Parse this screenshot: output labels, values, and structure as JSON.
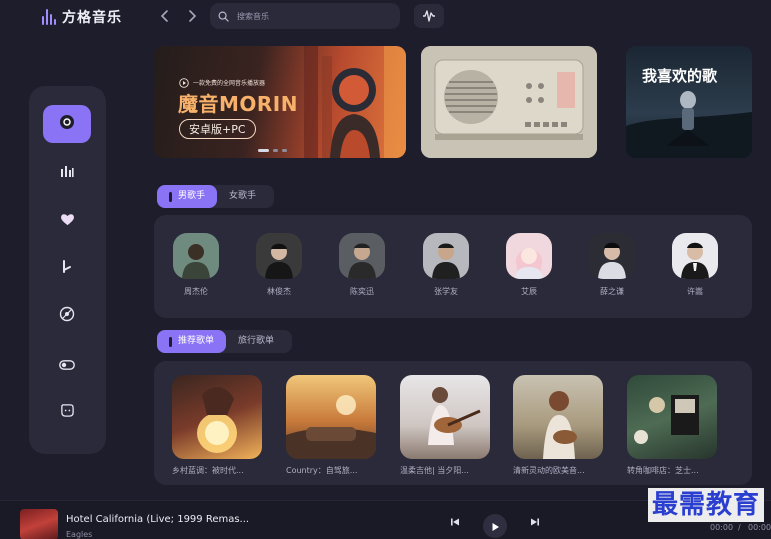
{
  "app": {
    "name": "方格音乐"
  },
  "search": {
    "placeholder": "搜索音乐"
  },
  "banners": {
    "b1_small": "一款免费的全网音乐播放器",
    "b1_title": "魔音MORIN",
    "b1_sub": "安卓版+PC",
    "b3_title": "我喜欢的歌"
  },
  "singer_tabs": [
    {
      "label": "男歌手",
      "active": true
    },
    {
      "label": "女歌手",
      "active": false
    }
  ],
  "singers": [
    {
      "name": "周杰伦",
      "bg": "#6f8a7e"
    },
    {
      "name": "林俊杰",
      "bg": "#3a3a3a"
    },
    {
      "name": "陈奕迅",
      "bg": "#5a5e62"
    },
    {
      "name": "张学友",
      "bg": "#b7b7be"
    },
    {
      "name": "艾辰",
      "bg": "#f0d8de"
    },
    {
      "name": "薛之谦",
      "bg": "#2c2c34"
    },
    {
      "name": "许嵩",
      "bg": "#e9e9ee"
    }
  ],
  "playlist_tabs": [
    {
      "label": "推荐歌单",
      "active": true
    },
    {
      "label": "旅行歌单",
      "active": false
    }
  ],
  "playlists": [
    {
      "title": "乡村蓝调：被时代...",
      "bg": "linear-gradient(160deg,#3a2620,#7a3b2a 50%,#f2b35a)"
    },
    {
      "title": "Country：自驾旅...",
      "bg": "linear-gradient(180deg,#f0c77a,#c87a3a 55%,#5a3a2a)"
    },
    {
      "title": "温柔吉他| 当夕阳...",
      "bg": "linear-gradient(180deg,#e8e6e8,#cfc6c2 60%,#8a7a70)"
    },
    {
      "title": "清新灵动的欧美音...",
      "bg": "linear-gradient(180deg,#c9c2b2,#a89a7e 60%,#6e6250)"
    },
    {
      "title": "转角咖啡店：芝士...",
      "bg": "linear-gradient(160deg,#2f4a3a,#4e6b54 50%,#27352c)"
    }
  ],
  "player": {
    "song_title": "Hotel California (Live; 1999 Remas...",
    "artist": "Eagles",
    "time_current": "00:00",
    "time_separator": "/",
    "time_total": "00:00"
  },
  "watermark": "最需教育",
  "colors": {
    "accent": "#8b73f6",
    "background": "#1d1d2b",
    "panel": "#2a2a3a"
  }
}
